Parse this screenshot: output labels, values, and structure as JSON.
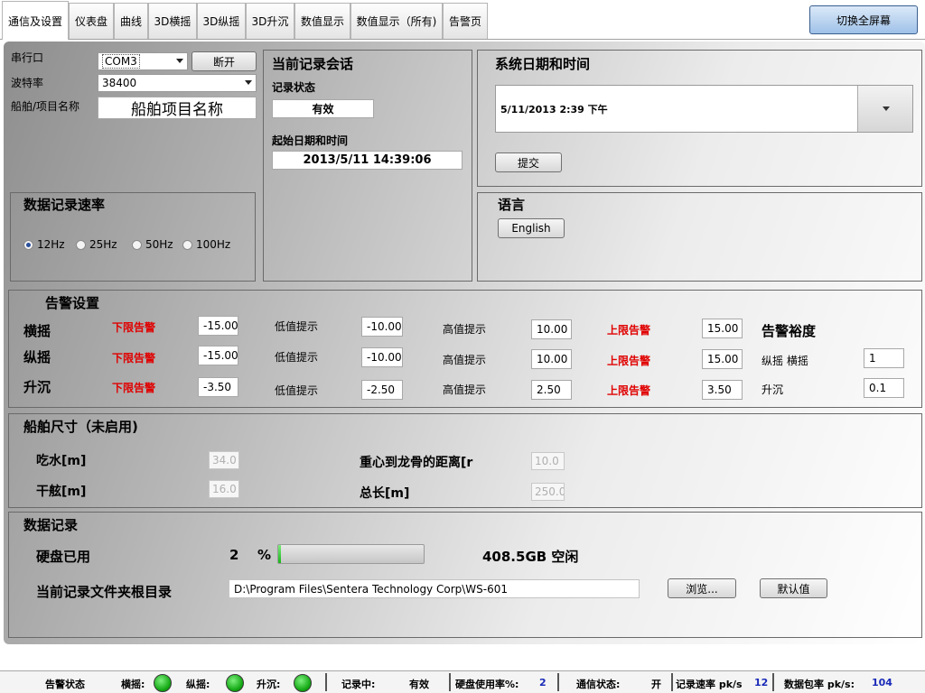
{
  "tabs": [
    "通信及设置",
    "仪表盘",
    "曲线",
    "3D横摇",
    "3D纵摇",
    "3D升沉",
    "数值显示",
    "数值显示（所有)",
    "告警页"
  ],
  "fullscreen_label": "切换全屏幕",
  "conn": {
    "port_label": "串行口",
    "port_value": "COM3",
    "disconnect": "断开",
    "baud_label": "波特率",
    "baud_value": "38400",
    "ship_label": "船舶/项目名称",
    "ship_value": "船舶项目名称"
  },
  "session": {
    "title": "当前记录会话",
    "state_label": "记录状态",
    "state_value": "有效",
    "start_label": "起始日期和时间",
    "start_value": "2013/5/11 14:39:06"
  },
  "sysdate": {
    "title": "系统日期和时间",
    "value": "5/11/2013 2:39 下午",
    "submit": "提交"
  },
  "rate": {
    "title": "数据记录速率",
    "options": [
      "12Hz",
      "25Hz",
      "50Hz",
      "100Hz"
    ],
    "selected": "12Hz"
  },
  "language": {
    "title": "语言",
    "button": "English"
  },
  "alarm": {
    "title": "告警设置",
    "low_alarm": "下限告警",
    "low_warn": "低值提示",
    "high_warn": "高值提示",
    "high_alarm": "上限告警",
    "rows": [
      {
        "name": "横摇",
        "low_alarm": "-15.00",
        "low_warn": "-10.00",
        "high_warn": "10.00",
        "high_alarm": "15.00"
      },
      {
        "name": "纵摇",
        "low_alarm": "-15.00",
        "low_warn": "-10.00",
        "high_warn": "10.00",
        "high_alarm": "15.00"
      },
      {
        "name": "升沉",
        "low_alarm": "-3.50",
        "low_warn": "-2.50",
        "high_warn": "2.50",
        "high_alarm": "3.50"
      }
    ],
    "tol_title": "告警裕度",
    "tol_pitch_roll_label": "纵摇 横摇",
    "tol_pitch_roll": "1",
    "tol_heave_label": "升沉",
    "tol_heave": "0.1"
  },
  "ship": {
    "title": "船舶尺寸（未启用)",
    "draft_label": "吃水[m]",
    "draft": "34.0",
    "freeboard_label": "干舷[m]",
    "freeboard": "16.0",
    "cg_label": "重心到龙骨的距离[r",
    "cg": "10.0",
    "length_label": "总长[m]",
    "length": "250.0"
  },
  "record": {
    "title": "数据记录",
    "disk_label": "硬盘已用",
    "disk_value": "2",
    "disk_unit": "%",
    "disk_percent": 2,
    "free": "408.5GB 空闲",
    "folder_label": "当前记录文件夹根目录",
    "folder_value": "D:\\Program Files\\Sentera Technology Corp\\WS-601",
    "browse": "浏览...",
    "default": "默认值"
  },
  "status": {
    "alarm_state": "告警状态",
    "roll": "横摇:",
    "pitch": "纵摇:",
    "heave": "升沉:",
    "recording": "记录中:",
    "recording_value": "有效",
    "disk": "硬盘使用率%:",
    "disk_value": "2",
    "comm": "通信状态:",
    "comm_value": "开",
    "rec_rate": "记录速率 pk/s",
    "rec_rate_value": "12",
    "pkt_rate": "数据包率 pk/s:",
    "pkt_rate_value": "104"
  },
  "colors": {
    "alarm_red": "#e00000",
    "status_blue": "#1a2ab8",
    "led_green": "#13a813"
  }
}
